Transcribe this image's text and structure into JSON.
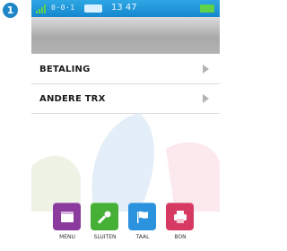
{
  "step_badge": "1",
  "status_bar": {
    "signal_text": "0·0·1",
    "time": "13 47",
    "bar_color": "#1f91d6",
    "battery_color": "#5dd24a"
  },
  "menu": {
    "items": [
      {
        "label": "BETALING",
        "icon": "chevron-right-icon"
      },
      {
        "label": "ANDERE TRX",
        "icon": "chevron-right-icon"
      }
    ]
  },
  "bottom_nav": {
    "items": [
      {
        "label": "MENU",
        "icon": "menu-icon",
        "color": "#8b3a9e"
      },
      {
        "label": "SLUITEN",
        "icon": "wrench-icon",
        "color": "#45b035"
      },
      {
        "label": "TAAL",
        "icon": "flag-icon",
        "color": "#2b92dd"
      },
      {
        "label": "BON",
        "icon": "printer-icon",
        "color": "#d63a63"
      }
    ]
  }
}
